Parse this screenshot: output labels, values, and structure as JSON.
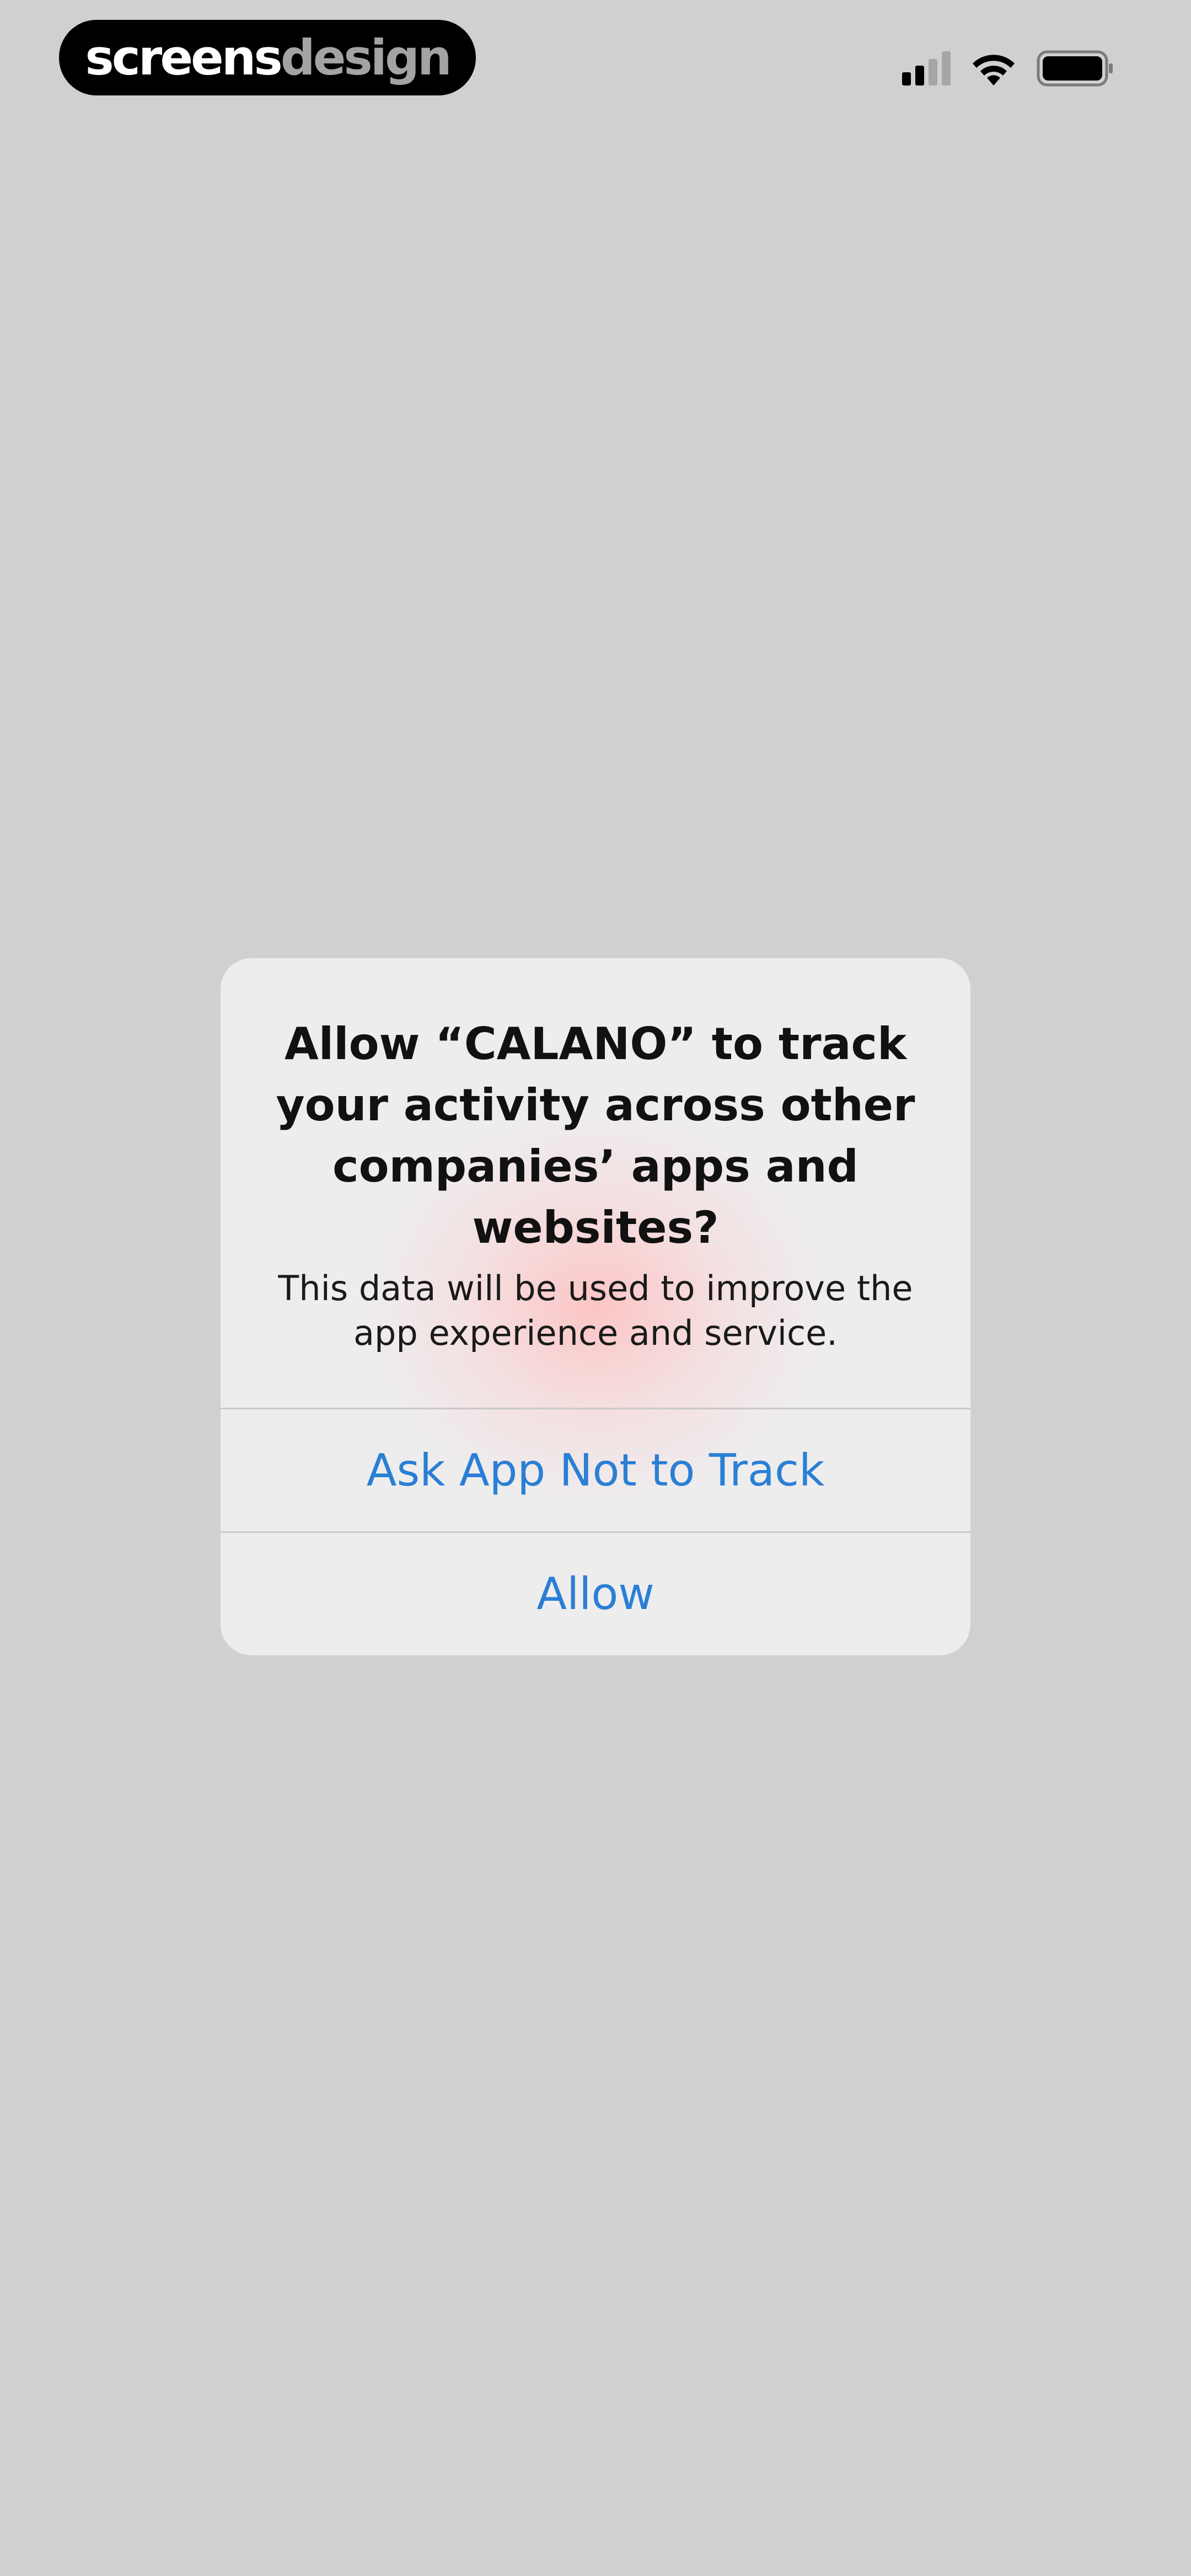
{
  "status_bar": {
    "brand_part1": "screens",
    "brand_part2": "design",
    "signal_icon": "cellular-signal-icon",
    "wifi_icon": "wifi-icon",
    "battery_icon": "battery-icon"
  },
  "alert": {
    "title": "Allow “CALANO” to track your activity across other companies’ apps and websites?",
    "message": "This data will be used to improve the app experience and service.",
    "buttons": [
      {
        "label": "Ask App Not to Track"
      },
      {
        "label": "Allow"
      }
    ]
  },
  "colors": {
    "background": "#d0cfd2",
    "alert_background": "#eeedee",
    "button_text": "#2a7fd5",
    "separator": "#c9c8cb"
  }
}
